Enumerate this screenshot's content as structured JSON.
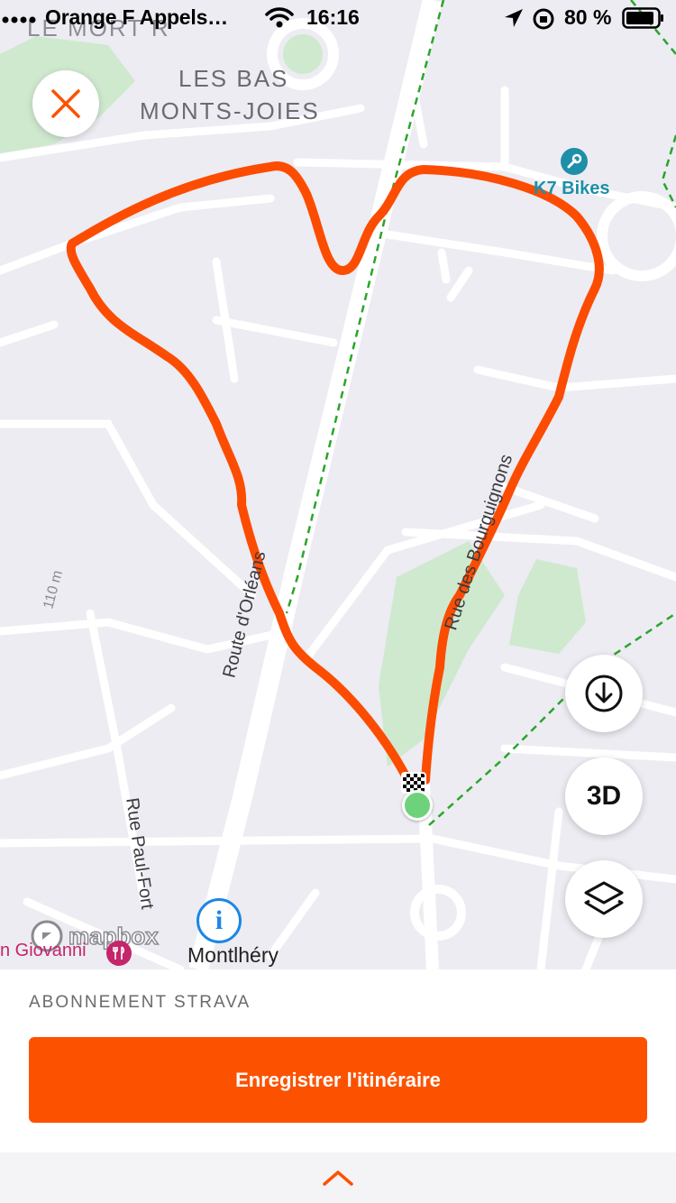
{
  "status_bar": {
    "carrier": "Orange F Appels…",
    "time": "16:16",
    "battery": "80 %"
  },
  "map": {
    "labels": {
      "top_left_partial": "LE MORT R",
      "district_line1": "LES BAS",
      "district_line2": "MONTS-JOIES",
      "poi_bikes": "K7 Bikes",
      "route_orleans": "Route d'Orléans",
      "rue_bourguignons": "Rue des Bourguignons",
      "rue_paul_fort": "Rue Paul-Fort",
      "elevation": "110 m",
      "montlhery": "Montlhéry",
      "restaurant": "n Giovanni",
      "attribution": "mapbox"
    },
    "icons": {
      "close": "close-icon",
      "download": "download-icon",
      "layers": "layers-icon",
      "info": "info-icon",
      "wrench": "wrench-icon",
      "restaurant": "restaurant-icon",
      "finish": "finish-flag-icon",
      "start": "start-marker-icon"
    },
    "button_3d": "3D",
    "route_color": "#fc4c02",
    "trail_color": "#2aa52a"
  },
  "panel": {
    "subscription_label": "ABONNEMENT STRAVA",
    "save_button": "Enregistrer l'itinéraire",
    "accent": "#fc5200"
  }
}
